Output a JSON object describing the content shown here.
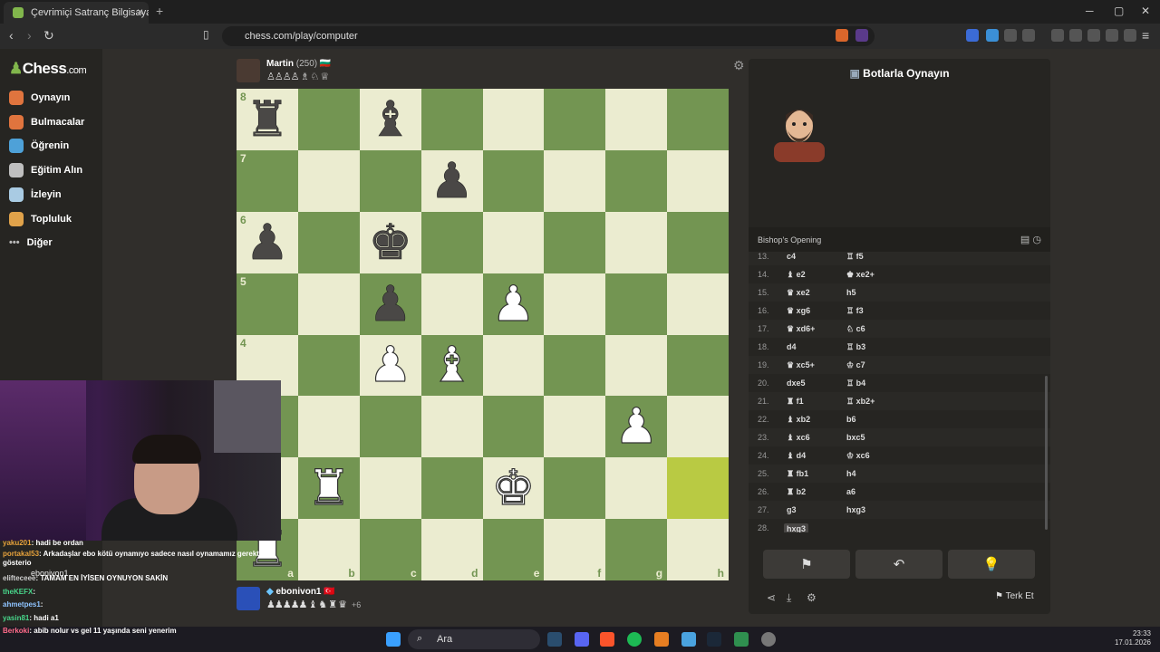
{
  "browser": {
    "tab_title": "Çevrimiçi Satranç Bilgisayara",
    "tab_close": "×",
    "new_tab": "+",
    "url": "chess.com/play/computer",
    "window_controls": [
      "─",
      "▢",
      "✕"
    ]
  },
  "sidebar": {
    "logo": "Chess",
    "logo_suffix": ".com",
    "items": [
      {
        "label": "Oynayın",
        "icon": "play-icon",
        "color": "#e0743e"
      },
      {
        "label": "Bulmacalar",
        "icon": "puzzle-icon",
        "color": "#e0743e"
      },
      {
        "label": "Öğrenin",
        "icon": "learn-icon",
        "color": "#4ea1d8"
      },
      {
        "label": "Eğitim Alın",
        "icon": "train-icon",
        "color": "#bfbfbf"
      },
      {
        "label": "İzleyin",
        "icon": "watch-icon",
        "color": "#a9cbe3"
      },
      {
        "label": "Topluluk",
        "icon": "community-icon",
        "color": "#e0a24a"
      },
      {
        "label": "Diğer",
        "icon": "more-icon",
        "color": "#bfbfbf"
      }
    ]
  },
  "opponent": {
    "name": "Martin",
    "rating": "(250)",
    "flag": "🇧🇬",
    "captured": "♙♙♙♙ ♗ ♘ ♕"
  },
  "player": {
    "name": "ebonivon1",
    "flag": "🇹🇷",
    "captured": "♟♟♟♟♟ ♝ ♞ ♜ ♛",
    "advantage": "+6"
  },
  "board": {
    "files": [
      "a",
      "b",
      "c",
      "d",
      "e",
      "f",
      "g",
      "h"
    ],
    "ranks": [
      "8",
      "7",
      "6",
      "5",
      "4",
      "3",
      "2",
      "1"
    ],
    "rows": [
      [
        "br",
        "",
        "bb",
        "",
        "",
        "",
        "",
        ""
      ],
      [
        "",
        "",
        "",
        "bp",
        "",
        "",
        "",
        ""
      ],
      [
        "bp",
        "",
        "bk",
        "",
        "",
        "",
        "",
        ""
      ],
      [
        "",
        "",
        "bp",
        "",
        "wp",
        "",
        "",
        ""
      ],
      [
        "",
        "",
        "wp",
        "wb",
        "",
        "",
        "",
        ""
      ],
      [
        "",
        "",
        "",
        "",
        "",
        "",
        "wp",
        ""
      ],
      [
        "",
        "wr",
        "",
        "",
        "wk",
        "",
        "",
        ""
      ],
      [
        "wr",
        "",
        "",
        "",
        "",
        "",
        "",
        ""
      ]
    ],
    "highlight": [
      "h2"
    ]
  },
  "panel": {
    "title": "Botlarla Oynayın",
    "opening": "Bishop's Opening",
    "moves": [
      {
        "n": "13.",
        "w": "c4",
        "b": "♖ f5"
      },
      {
        "n": "14.",
        "w": "♝ e2",
        "b": "♚ xe2+"
      },
      {
        "n": "15.",
        "w": "♛ xe2",
        "b": "h5"
      },
      {
        "n": "16.",
        "w": "♛ xg6",
        "b": "♖ f3"
      },
      {
        "n": "17.",
        "w": "♛ xd6+",
        "b": "♘ c6"
      },
      {
        "n": "18.",
        "w": "d4",
        "b": "♖ b3"
      },
      {
        "n": "19.",
        "w": "♛ xc5+",
        "b": "♔ c7"
      },
      {
        "n": "20.",
        "w": "dxe5",
        "b": "♖ b4"
      },
      {
        "n": "21.",
        "w": "♜ f1",
        "b": "♖ xb2+"
      },
      {
        "n": "22.",
        "w": "♝ xb2",
        "b": "b6"
      },
      {
        "n": "23.",
        "w": "♝ xc6",
        "b": "bxc5"
      },
      {
        "n": "24.",
        "w": "♝ d4",
        "b": "♔ xc6"
      },
      {
        "n": "25.",
        "w": "♜ fb1",
        "b": "h4"
      },
      {
        "n": "26.",
        "w": "♜ b2",
        "b": "a6"
      },
      {
        "n": "27.",
        "w": "g3",
        "b": "hxg3"
      },
      {
        "n": "28.",
        "w": "hxg3",
        "b": ""
      }
    ],
    "buttons": {
      "flag": "⚑",
      "undo": "↶",
      "hint": "💡"
    },
    "resign_label": "Terk Et",
    "resign_icon": "⚑"
  },
  "chat": [
    {
      "user": "yaku201",
      "text": ": hadi be ordan"
    },
    {
      "user": "portakal53",
      "text": ": Arkadaşlar ebo kötü oynamıyo sadece nasıl oynamamız gerektiğini gösterio"
    },
    {
      "user": "elifteceee",
      "text": ": TAMAM EN İYİSEN OYNUYON SAKİN"
    },
    {
      "user": "theKEFX",
      "text": ":"
    },
    {
      "user": "ahmetpes1",
      "text": ":"
    },
    {
      "user": "yasin81",
      "text": ": hadi a1"
    },
    {
      "user": "Berkoki",
      "text": ": abib nolur vs gel 11 yaşında seni yenerim"
    }
  ],
  "chat_extra": "ebonivon1",
  "taskbar": {
    "search": "Ara",
    "time": "23:33",
    "date": "17.01.2026"
  }
}
